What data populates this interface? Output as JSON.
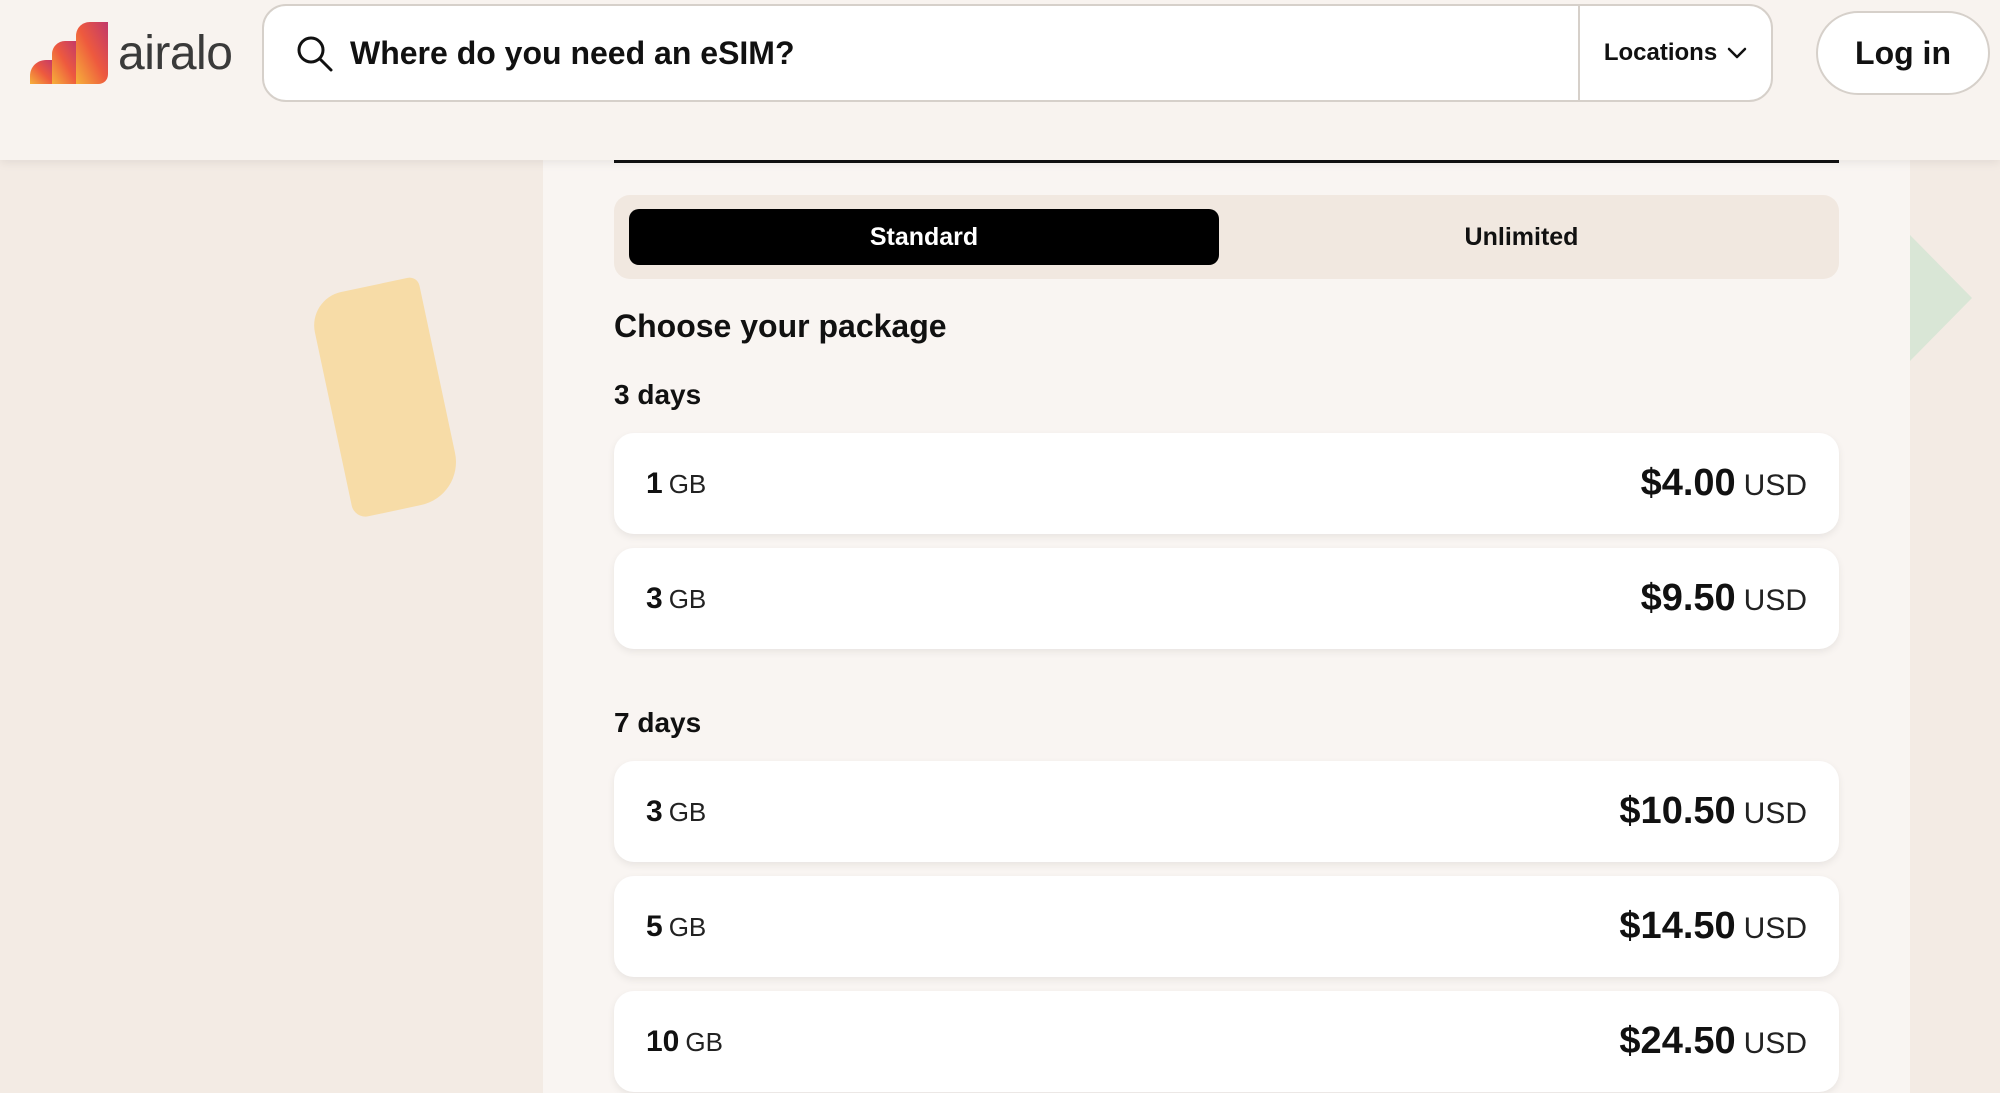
{
  "brand": {
    "name": "airalo"
  },
  "header": {
    "search_placeholder": "Where do you need an eSIM?",
    "locations_label": "Locations",
    "login_label": "Log in"
  },
  "plan_tabs": [
    {
      "label": "Standard",
      "selected": true
    },
    {
      "label": "Unlimited",
      "selected": false
    }
  ],
  "heading": "Choose your package",
  "groups": [
    {
      "label": "3 days",
      "packages": [
        {
          "amount": "1",
          "unit": "GB",
          "price": "$4.00",
          "currency": "USD"
        },
        {
          "amount": "3",
          "unit": "GB",
          "price": "$9.50",
          "currency": "USD"
        }
      ]
    },
    {
      "label": "7 days",
      "packages": [
        {
          "amount": "3",
          "unit": "GB",
          "price": "$10.50",
          "currency": "USD"
        },
        {
          "amount": "5",
          "unit": "GB",
          "price": "$14.50",
          "currency": "USD"
        },
        {
          "amount": "10",
          "unit": "GB",
          "price": "$24.50",
          "currency": "USD"
        }
      ]
    }
  ],
  "colors": {
    "background": "#f3ebe4",
    "panel": "#f9f5f2",
    "selected_tab": "#000000",
    "accent_yellow": "#f7dca7",
    "accent_green": "#d9e6d6"
  }
}
